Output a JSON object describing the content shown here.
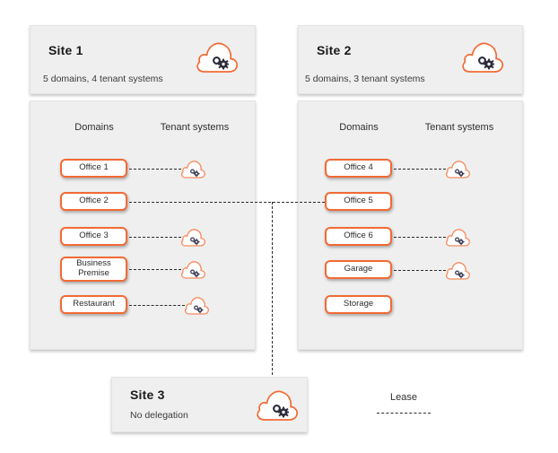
{
  "diagram": {
    "title_fragment": "",
    "accent_color": "#f26a34",
    "panel_color": "#efefef",
    "line_color": "#2b2b2b"
  },
  "sites": [
    {
      "id": "site-1",
      "title": "Site 1",
      "subtitle": "5 domains, 4 tenant systems",
      "icon": "cloud-gears-icon",
      "columns": {
        "domains": "Domains",
        "tenants": "Tenant systems"
      },
      "domains": [
        {
          "label": "Office 1",
          "has_tenant": true,
          "tenant_icon": "cloud-gears-small-icon"
        },
        {
          "label": "Office 2",
          "has_tenant": false,
          "tenant_icon": ""
        },
        {
          "label": "Office 3",
          "has_tenant": true,
          "tenant_icon": "cloud-gears-small-icon"
        },
        {
          "label": "Business\nPremise",
          "has_tenant": true,
          "tenant_icon": "cloud-gears-small-icon"
        },
        {
          "label": "Restaurant",
          "has_tenant": true,
          "tenant_icon": "cloud-gears-small-icon"
        }
      ]
    },
    {
      "id": "site-2",
      "title": "Site 2",
      "subtitle": "5 domains, 3 tenant systems",
      "icon": "cloud-gears-icon",
      "columns": {
        "domains": "Domains",
        "tenants": "Tenant systems"
      },
      "domains": [
        {
          "label": "Office 4",
          "has_tenant": true,
          "tenant_icon": "cloud-gears-small-icon"
        },
        {
          "label": "Office 5",
          "has_tenant": false,
          "tenant_icon": ""
        },
        {
          "label": "Office 6",
          "has_tenant": true,
          "tenant_icon": "cloud-gears-small-icon"
        },
        {
          "label": "Garage",
          "has_tenant": true,
          "tenant_icon": "cloud-gears-small-icon"
        },
        {
          "label": "Storage",
          "has_tenant": false,
          "tenant_icon": ""
        }
      ]
    },
    {
      "id": "site-3",
      "title": "Site 3",
      "subtitle": "No delegation",
      "icon": "cloud-gears-icon",
      "columns": {
        "domains": "",
        "tenants": ""
      },
      "domains": []
    }
  ],
  "legend": {
    "label": "Lease",
    "line_style": "dashed"
  }
}
